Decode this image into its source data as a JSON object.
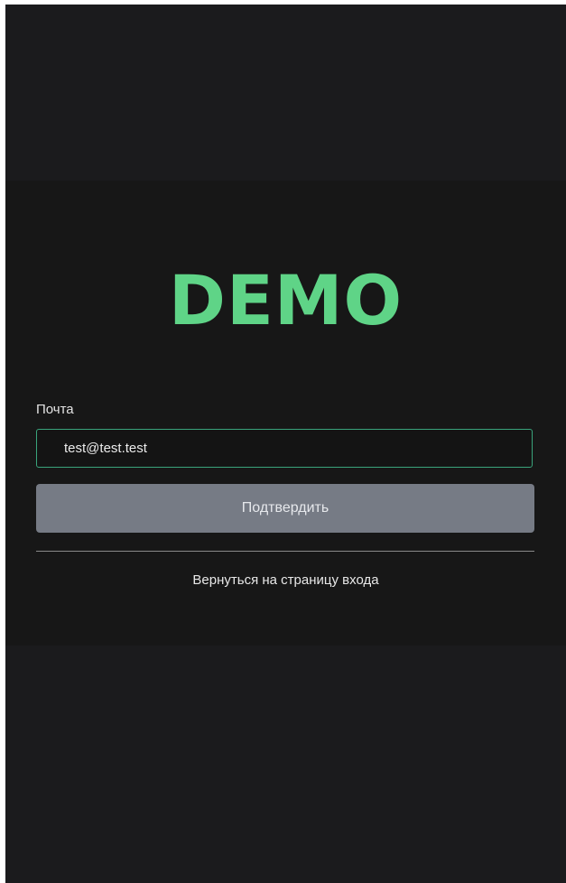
{
  "logo": {
    "text": "DEMO",
    "color": "#5fd487"
  },
  "form": {
    "email_label": "Почта",
    "email_value": "test@test.test",
    "submit_label": "Подтвердить"
  },
  "footer": {
    "back_link_label": "Вернуться на страницу входа"
  },
  "colors": {
    "background": "#1b1b1d",
    "card": "#171717",
    "accent": "#3aa47c",
    "button": "#767b85"
  }
}
